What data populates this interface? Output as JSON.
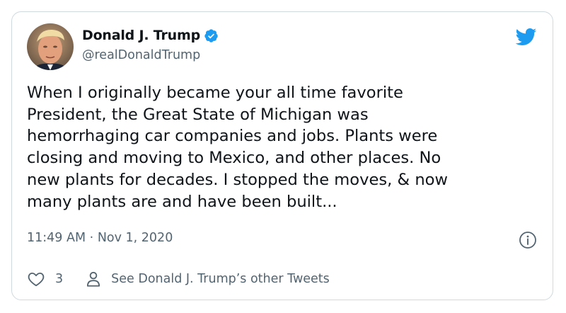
{
  "author": {
    "display_name": "Donald J. Trump",
    "handle": "@realDonaldTrump",
    "verified": true
  },
  "tweet": {
    "text": "When I originally became your all time favorite\nPresident, the Great State of Michigan was\nhemorrhaging car companies and jobs. Plants were\nclosing and moving to Mexico, and other places. No\nnew plants for decades. I stopped the moves, & now\nmany plants are and have been built...",
    "time": "11:49 AM",
    "separator": "·",
    "date": "Nov 1, 2020"
  },
  "actions": {
    "like_count": "3",
    "other_tweets_label": "See Donald J. Trump’s other Tweets"
  },
  "icons": {
    "brand": "twitter-bird-icon",
    "verified": "verified-badge-icon",
    "info": "info-icon",
    "like": "heart-icon",
    "profile": "person-icon"
  },
  "colors": {
    "brand_blue": "#1d9bf0",
    "text_primary": "#0f1419",
    "text_secondary": "#536471",
    "border": "#cfd9de"
  }
}
